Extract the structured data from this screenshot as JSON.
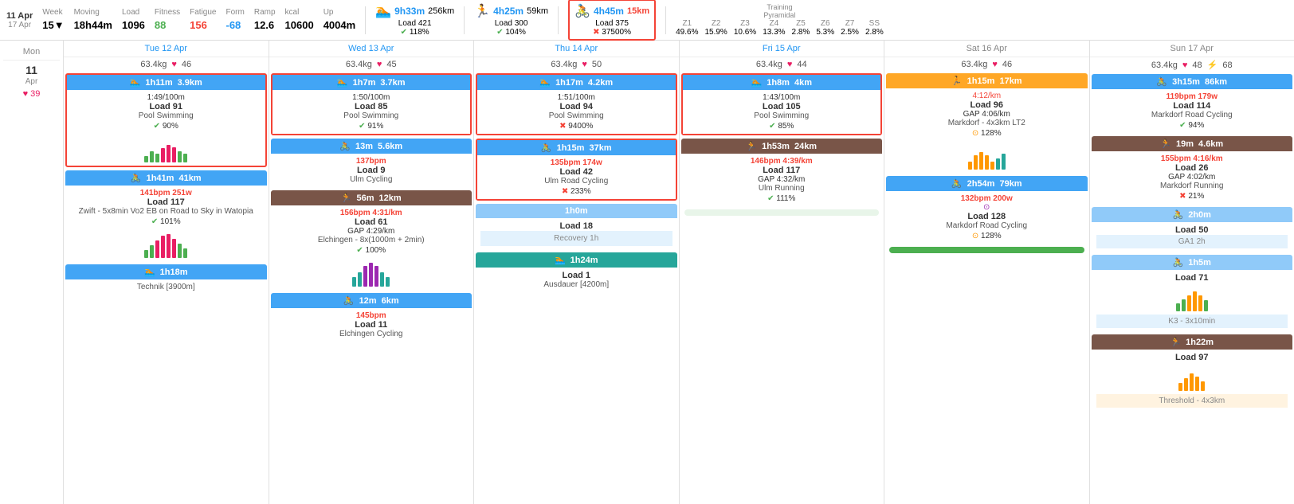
{
  "topbar": {
    "week": {
      "start": "11 Apr",
      "end": "17 Apr",
      "label": "Week",
      "sub": "15▼"
    },
    "moving": {
      "label": "Moving",
      "value": "18h44m"
    },
    "load": {
      "label": "Load",
      "value": "1096"
    },
    "fitness": {
      "label": "Fitness",
      "value": "88"
    },
    "fatigue": {
      "label": "Fatigue",
      "value": "156"
    },
    "form": {
      "label": "Form",
      "value": "-68"
    },
    "ramp": {
      "label": "Ramp",
      "value": "12.6"
    },
    "kcal": {
      "label": "kcal",
      "value": "10600"
    },
    "up": {
      "label": "Up",
      "value": "4004m"
    },
    "swim": {
      "time": "9h33m",
      "dist": "256km",
      "load_label": "Load 421",
      "pct": "118%",
      "icon": "🏊"
    },
    "run": {
      "time": "4h25m",
      "dist": "59km",
      "load_label": "Load 300",
      "pct": "104%",
      "icon": "🏃"
    },
    "bike": {
      "time": "4h45m",
      "dist": "15km",
      "load_label": "Load 375",
      "pct": "37500%",
      "icon": "🚴",
      "highlighted": true
    },
    "zones": {
      "label": "Training\nPyramidal",
      "z1": {
        "label": "Z1",
        "value": "49.6%"
      },
      "z2": {
        "label": "Z2",
        "value": "15.9%"
      },
      "z3": {
        "label": "Z3",
        "value": "10.6%"
      },
      "z4": {
        "label": "Z4",
        "value": "13.3%"
      },
      "z5": {
        "label": "Z5",
        "value": "2.8%"
      },
      "z6": {
        "label": "Z6",
        "value": "5.3%"
      },
      "z7": {
        "label": "Z7",
        "value": "2.5%"
      },
      "ss": {
        "label": "SS",
        "value": "2.8%"
      }
    }
  },
  "mon": {
    "date": "11",
    "month": "Apr",
    "label": "Mon",
    "heart": "39"
  },
  "days": [
    {
      "label": "Tue 12 Apr",
      "weight": "63.4kg",
      "heart": "46",
      "activities": [
        {
          "type": "swim",
          "header_color": "swim",
          "time": "1h11m",
          "dist": "3.9km",
          "pace": "1:49/100m",
          "load": "Load 91",
          "name": "Pool Swimming",
          "status_icon": "check",
          "status_pct": "90%",
          "bordered": true,
          "bars": [
            3,
            5,
            4,
            6,
            8,
            7,
            5,
            4,
            3,
            5,
            6
          ]
        },
        {
          "type": "bike",
          "header_color": "bike",
          "time": "1h41m",
          "dist": "41km",
          "bpm": "141bpm",
          "watt": "251w",
          "load": "Load 117",
          "name": "Zwift - 5x8min Vo2 EB on Road to Sky in Watopia",
          "status_icon": "check",
          "status_pct": "101%",
          "bars": [
            4,
            6,
            8,
            10,
            12,
            9,
            7,
            5,
            4,
            6,
            8,
            7
          ]
        },
        {
          "type": "swim",
          "header_color": "swim",
          "time": "1h18m",
          "dist": "",
          "name": "Technik [3900m]",
          "noload": true
        }
      ]
    },
    {
      "label": "Wed 13 Apr",
      "weight": "63.4kg",
      "heart": "45",
      "activities": [
        {
          "type": "swim",
          "header_color": "swim",
          "time": "1h7m",
          "dist": "3.7km",
          "pace": "1:50/100m",
          "load": "Load 85",
          "name": "Pool Swimming",
          "status_icon": "check",
          "status_pct": "91%",
          "bordered": true
        },
        {
          "type": "bike",
          "header_color": "bike",
          "time": "13m",
          "dist": "5.6km",
          "bpm": "137bpm",
          "load": "Load 9",
          "name": "Ulm Cycling"
        },
        {
          "type": "run",
          "header_color": "brown",
          "time": "56m",
          "dist": "12km",
          "bpm": "156bpm",
          "pace2": "4:31/km",
          "load": "Load 61",
          "gap": "GAP 4:29/km",
          "name": "Elchingen - 8x(1000m + 2min)",
          "status_icon": "check",
          "status_pct": "100%",
          "bars": [
            5,
            7,
            9,
            11,
            13,
            11,
            9,
            7,
            5,
            7,
            9
          ]
        },
        {
          "type": "bike",
          "header_color": "bike",
          "time": "12m",
          "dist": "6km",
          "bpm": "145bpm",
          "load": "Load 11",
          "name": "Elchingen Cycling"
        }
      ]
    },
    {
      "label": "Thu 14 Apr",
      "weight": "63.4kg",
      "heart": "50",
      "activities": [
        {
          "type": "swim",
          "header_color": "swim",
          "time": "1h17m",
          "dist": "4.2km",
          "pace": "1:51/100m",
          "load": "Load 94",
          "name": "Pool Swimming",
          "status_icon": "cross",
          "status_pct": "9400%",
          "bordered": true
        },
        {
          "type": "bike",
          "header_color": "bike",
          "time": "1h15m",
          "dist": "37km",
          "bpm": "135bpm",
          "watt": "174w",
          "load": "Load 42",
          "name": "Ulm Road Cycling",
          "status_icon": "cross",
          "status_pct": "233%"
        },
        {
          "type": "bike",
          "header_color": "light-blue",
          "time": "1h0m",
          "dist": "",
          "load": "Load 18",
          "noload": false
        },
        {
          "type": "swim",
          "header_color": "teal",
          "time": "1h24m",
          "dist": "",
          "load": "Load 1",
          "name": "Ausdauer [4200m]",
          "noload": false
        }
      ]
    },
    {
      "label": "Fri 15 Apr",
      "weight": "63.4kg",
      "heart": "44",
      "activities": [
        {
          "type": "swim",
          "header_color": "swim",
          "time": "1h8m",
          "dist": "4km",
          "pace": "1:43/100m",
          "load": "Load 105",
          "name": "Pool Swimming",
          "status_icon": "check",
          "status_pct": "85%",
          "bordered": true
        },
        {
          "type": "run",
          "header_color": "brown",
          "time": "1h53m",
          "dist": "24km",
          "bpm": "146bpm",
          "pace2": "4:39/km",
          "load": "Load 117",
          "gap": "GAP 4:32/km",
          "name": "Ulm Running",
          "status_icon": "check",
          "status_pct": "111%"
        }
      ]
    },
    {
      "label": "Sat 16 Apr",
      "weight": "63.4kg",
      "heart": "46",
      "activities": [
        {
          "type": "run",
          "header_color": "orange",
          "time": "1h15m",
          "dist": "17km",
          "extra": "4:12/km",
          "load": "Load 96",
          "gap": "GAP 4:06/km",
          "name": "Markdorf - 4x3km LT2",
          "status_icon": "orange",
          "status_pct": "128%"
        },
        {
          "type": "bike",
          "header_color": "bike",
          "time": "2h54m",
          "dist": "79km",
          "bpm": "132bpm",
          "watt": "200w",
          "load": "Load 128",
          "name": "Markdorf Road Cycling",
          "status_icon": "orange",
          "status_pct": "128%"
        }
      ]
    },
    {
      "label": "Sun 17 Apr",
      "weight": "63.4kg",
      "heart": "48",
      "heart2": "68",
      "activities": [
        {
          "type": "run",
          "header_color": "orange",
          "time": "3h15m",
          "dist": "86km",
          "bpm": "119bpm",
          "extra": "179w",
          "load": "Load 114",
          "name": "Markdorf Road Cycling",
          "status_icon": "check",
          "status_pct": "94%"
        },
        {
          "type": "run",
          "header_color": "brown",
          "time": "19m",
          "dist": "4.6km",
          "bpm": "155bpm",
          "pace2": "4:16/km",
          "load": "Load 26",
          "gap": "GAP 4:02/km",
          "name": "Markdorf Running",
          "status_icon": "cross",
          "status_pct": "21%"
        },
        {
          "type": "bike",
          "header_color": "light-blue",
          "time": "2h0m",
          "dist": "",
          "load": "Load 50",
          "name": "GA1 2h"
        },
        {
          "type": "bike",
          "header_color": "light-blue",
          "time": "1h5m",
          "dist": "",
          "load": "Load 71",
          "name": "K3 - 3x10min"
        },
        {
          "type": "run",
          "header_color": "brown",
          "time": "1h22m",
          "dist": "",
          "load": "Load 97",
          "name": "Threshold - 4x3km"
        }
      ]
    }
  ]
}
